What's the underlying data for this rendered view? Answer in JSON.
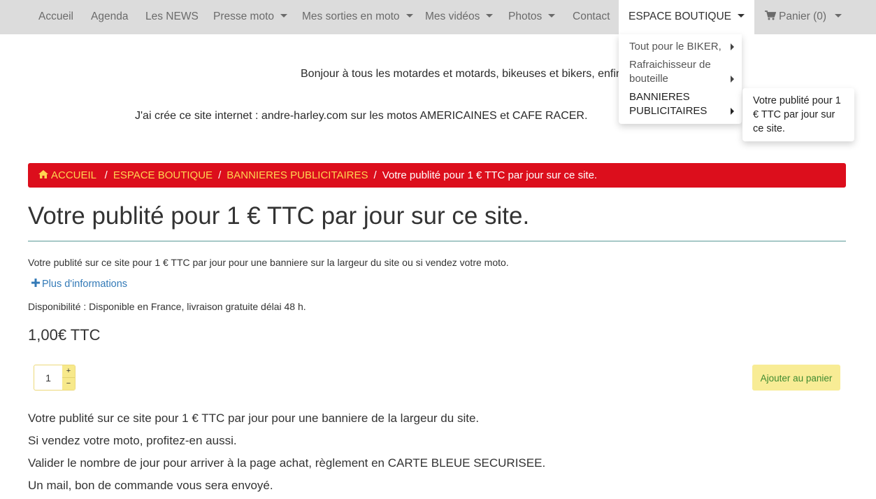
{
  "nav": {
    "items": [
      {
        "label": "Accueil"
      },
      {
        "label": "Agenda"
      },
      {
        "label": "Les NEWS"
      },
      {
        "label": "Presse moto"
      },
      {
        "label": "Mes sorties en moto"
      },
      {
        "label": "Mes vidéos"
      },
      {
        "label": "Photos"
      },
      {
        "label": "Contact"
      },
      {
        "label": "ESPACE BOUTIQUE"
      }
    ],
    "cart_label": "Panier (0)"
  },
  "dropdown": {
    "items": [
      {
        "label": "Tout pour le BIKER,"
      },
      {
        "label_line1": "Rafraichisseur de",
        "label_line2": "bouteille"
      },
      {
        "label_line1": "BANNIERES",
        "label_line2": "PUBLICITAIRES"
      }
    ],
    "submenu": {
      "label": "Votre publité pour 1 € TTC par jour sur ce site."
    }
  },
  "intro": {
    "line1": "Bonjour à tous les motardes et motards, bikeuses et bikers, enfin",
    "line2": "J'ai crée ce site internet : andre-harley.com sur les motos AMERICAINES et CAFE RACER."
  },
  "breadcrumb": {
    "home": "ACCUEIL",
    "level1": "ESPACE BOUTIQUE",
    "level2": "BANNIERES PUBLICITAIRES",
    "current": "Votre publité pour 1 € TTC par jour sur ce site.",
    "separator": "/"
  },
  "product": {
    "title": "Votre publité pour 1 € TTC par jour sur ce site.",
    "short_description": "Votre publité sur ce site pour 1 € TTC par jour pour une banniere sur la largeur du site ou si vendez votre moto.",
    "more_info": "Plus d'informations",
    "availability": "Disponibilité : Disponible en France, livraison gratuite délai 48 h.",
    "price": "1,00€ TTC",
    "quantity": "1",
    "qty_plus": "+",
    "qty_minus": "−",
    "add_to_cart": "Ajouter au panier"
  },
  "description": {
    "lines": [
      "Votre publité sur ce site pour 1 € TTC par jour pour une banniere de la largeur du site.",
      "Si vendez votre moto, profitez-en aussi.",
      "Valider le nombre de jour pour arriver à la page achat, règlement en CARTE BLEUE SECURISEE.",
      "Un mail, bon de commande vous sera envoyé."
    ]
  },
  "colors": {
    "navbar": "#dcdcdc",
    "breadcrumb_bg": "#dc0e1c",
    "breadcrumb_link": "#ffd451",
    "button_bg": "#f8ec95",
    "button_text": "#3f8a30",
    "link": "#337ab7"
  }
}
